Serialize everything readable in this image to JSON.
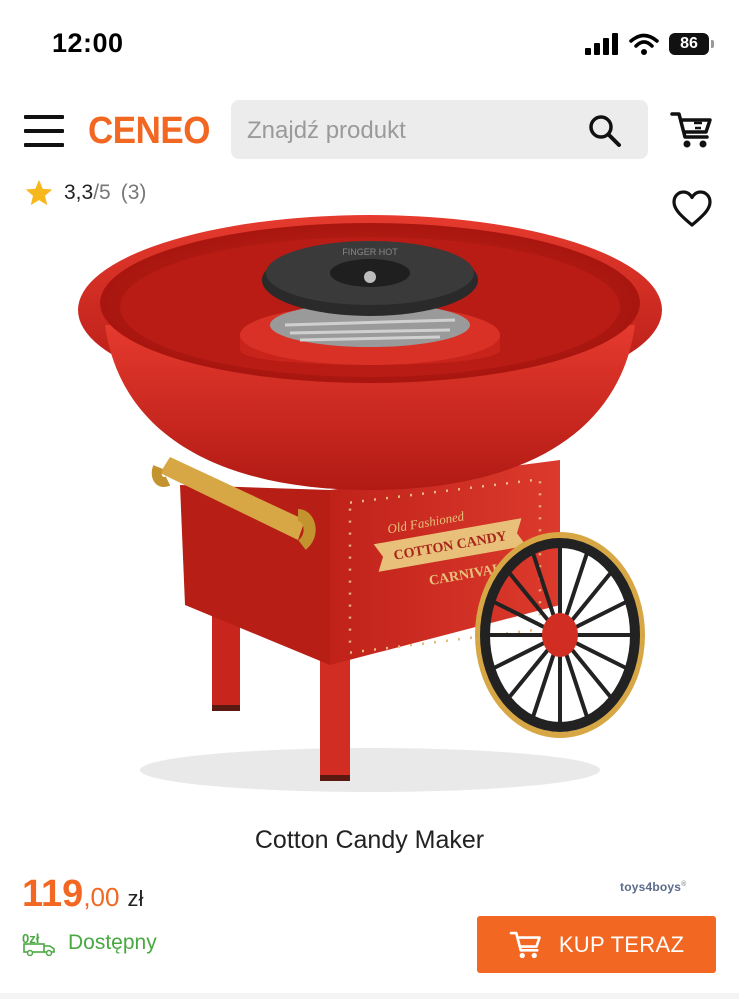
{
  "status_bar": {
    "time": "12:00",
    "battery": "86"
  },
  "header": {
    "logo": "CENEO",
    "search_placeholder": "Znajdź produkt",
    "icons": [
      "menu-icon",
      "search-icon",
      "cart-icon"
    ]
  },
  "product": {
    "rating_value": "3,3",
    "rating_max": "/5",
    "rating_count": "(3)",
    "title": "Cotton Candy Maker",
    "image_text": {
      "line1": "Old Fashioned",
      "line2": "COTTON CANDY",
      "line3": "CARNIVAL",
      "lid": "FINGER HOT"
    },
    "price_integer": "119",
    "price_decimal": ",00",
    "currency": "zł",
    "availability": "Dostępny",
    "delivery_badge": "0zł",
    "shop": "toys4boys",
    "shop_mark": "®",
    "buy_label": "KUP TERAZ"
  },
  "colors": {
    "accent": "#f26722",
    "available": "#4aa842",
    "product_red": "#d8281f"
  }
}
